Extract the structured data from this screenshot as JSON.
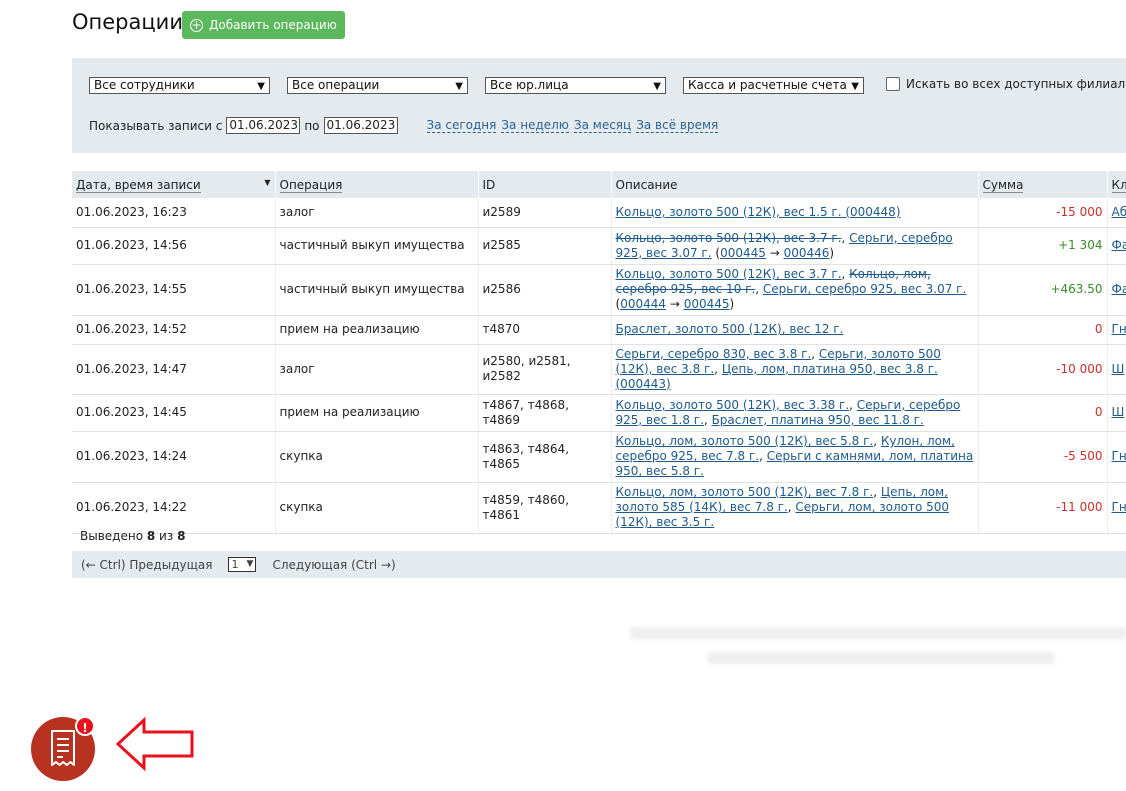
{
  "header": {
    "title": "Операции",
    "add_button": "Добавить операцию"
  },
  "filters": {
    "employees": "Все сотрудники",
    "operations": "Все операции",
    "legal_entities": "Все юр.лица",
    "accounts": "Касса и расчетные счета",
    "all_branches_label": "Искать во всех доступных филиалах",
    "show_records_from": "Показывать записи с",
    "date_from": "01.06.2023",
    "to_label": "по",
    "date_to": "01.06.2023",
    "periods": [
      "За сегодня",
      "За неделю",
      "За месяц",
      "За всё время"
    ]
  },
  "table": {
    "columns": [
      "Дата, время записи",
      "Операция",
      "ID",
      "Описание",
      "Сумма",
      "Кл"
    ],
    "rows": [
      {
        "date": "01.06.2023, 16:23",
        "op": "залог",
        "id": "и2589",
        "desc": [
          {
            "t": "Кольцо, золото 500 (12К), вес 1.5 г. (000448)",
            "k": "link"
          }
        ],
        "sum": "-15 000",
        "sign": "neg",
        "client": "Аб"
      },
      {
        "date": "01.06.2023, 14:56",
        "op": "частичный выкуп имущества",
        "id": "и2585",
        "desc": [
          {
            "t": "Кольцо, золото 500 (12К), вес 3.7 г.",
            "k": "strike"
          },
          {
            "t": ", ",
            "k": "text"
          },
          {
            "t": "Серьги, серебро 925, вес 3.07 г.",
            "k": "link"
          },
          {
            "t": " (",
            "k": "text"
          },
          {
            "t": "000445",
            "k": "link"
          },
          {
            "t": " → ",
            "k": "text"
          },
          {
            "t": "000446",
            "k": "link"
          },
          {
            "t": ")",
            "k": "text"
          }
        ],
        "sum": "+1 304",
        "sign": "pos",
        "client": "Фа"
      },
      {
        "date": "01.06.2023, 14:55",
        "op": "частичный выкуп имущества",
        "id": "и2586",
        "desc": [
          {
            "t": "Кольцо, золото 500 (12К), вес 3.7 г.",
            "k": "link"
          },
          {
            "t": ", ",
            "k": "text"
          },
          {
            "t": "Кольцо, лом, серебро 925, вес 10 г.",
            "k": "strike"
          },
          {
            "t": ", ",
            "k": "text"
          },
          {
            "t": "Серьги, серебро 925, вес 3.07 г.",
            "k": "link"
          },
          {
            "t": " (",
            "k": "text"
          },
          {
            "t": "000444",
            "k": "link"
          },
          {
            "t": " → ",
            "k": "text"
          },
          {
            "t": "000445",
            "k": "link"
          },
          {
            "t": ")",
            "k": "text"
          }
        ],
        "sum": "+463.50",
        "sign": "pos",
        "client": "Фа"
      },
      {
        "date": "01.06.2023, 14:52",
        "op": "прием на реализацию",
        "id": "т4870",
        "desc": [
          {
            "t": "Браслет, золото 500 (12К), вес 12 г.",
            "k": "link"
          }
        ],
        "sum": "0",
        "sign": "neg",
        "client": "Гн"
      },
      {
        "date": "01.06.2023, 14:47",
        "op": "залог",
        "id": "и2580, и2581, и2582",
        "desc": [
          {
            "t": "Серьги, серебро 830, вес 3.8 г.",
            "k": "link"
          },
          {
            "t": ", ",
            "k": "text"
          },
          {
            "t": "Серьги, золото 500 (12К), вес 3.8 г.",
            "k": "link"
          },
          {
            "t": ", ",
            "k": "text"
          },
          {
            "t": "Цепь, лом, платина 950, вес 3.8 г. (000443)",
            "k": "link"
          }
        ],
        "sum": "-10 000",
        "sign": "neg",
        "client": "Ш"
      },
      {
        "date": "01.06.2023, 14:45",
        "op": "прием на реализацию",
        "id": "т4867, т4868, т4869",
        "desc": [
          {
            "t": "Кольцо, золото 500 (12К), вес 3.38 г.",
            "k": "link"
          },
          {
            "t": ", ",
            "k": "text"
          },
          {
            "t": "Серьги, серебро 925, вес 1.8 г.",
            "k": "link"
          },
          {
            "t": ", ",
            "k": "text"
          },
          {
            "t": "Браслет, платина 950, вес 11.8 г.",
            "k": "link"
          }
        ],
        "sum": "0",
        "sign": "neg",
        "client": "Ш"
      },
      {
        "date": "01.06.2023, 14:24",
        "op": "скупка",
        "id": "т4863, т4864, т4865",
        "desc": [
          {
            "t": "Кольцо, лом, золото 500 (12К), вес 5.8 г.",
            "k": "link"
          },
          {
            "t": ", ",
            "k": "text"
          },
          {
            "t": "Кулон, лом, серебро 925, вес 7.8 г.",
            "k": "link"
          },
          {
            "t": ", ",
            "k": "text"
          },
          {
            "t": "Серьги с камнями, лом, платина 950, вес 5.8 г.",
            "k": "link"
          }
        ],
        "sum": "-5 500",
        "sign": "neg",
        "client": "Гн"
      },
      {
        "date": "01.06.2023, 14:22",
        "op": "скупка",
        "id": "т4859, т4860, т4861",
        "desc": [
          {
            "t": "Кольцо, лом, золото 500 (12К), вес 7.8 г.",
            "k": "link"
          },
          {
            "t": ", ",
            "k": "text"
          },
          {
            "t": "Цепь, лом, золото 585 (14К), вес 7.8 г.",
            "k": "link"
          },
          {
            "t": ", ",
            "k": "text"
          },
          {
            "t": "Серьги, лом, золото 500 (12К), вес 3.5 г.",
            "k": "link"
          }
        ],
        "sum": "-11 000",
        "sign": "neg",
        "client": "Гн"
      }
    ]
  },
  "summary": {
    "shown_label": "Выведено",
    "shown": "8",
    "of_label": "из",
    "total": "8"
  },
  "pager": {
    "prev": "(← Ctrl) Предыдущая",
    "page": "1",
    "next": "Следующая (Ctrl →)"
  },
  "fab": {
    "icon": "receipt-icon",
    "badge": "!"
  },
  "colors": {
    "accent_green": "#5cb85c",
    "panel_bg": "#e4eaee",
    "negative": "#c9302c",
    "positive": "#3c8a2c",
    "fab_bg": "#b83220",
    "arrow": "#e8121c"
  }
}
